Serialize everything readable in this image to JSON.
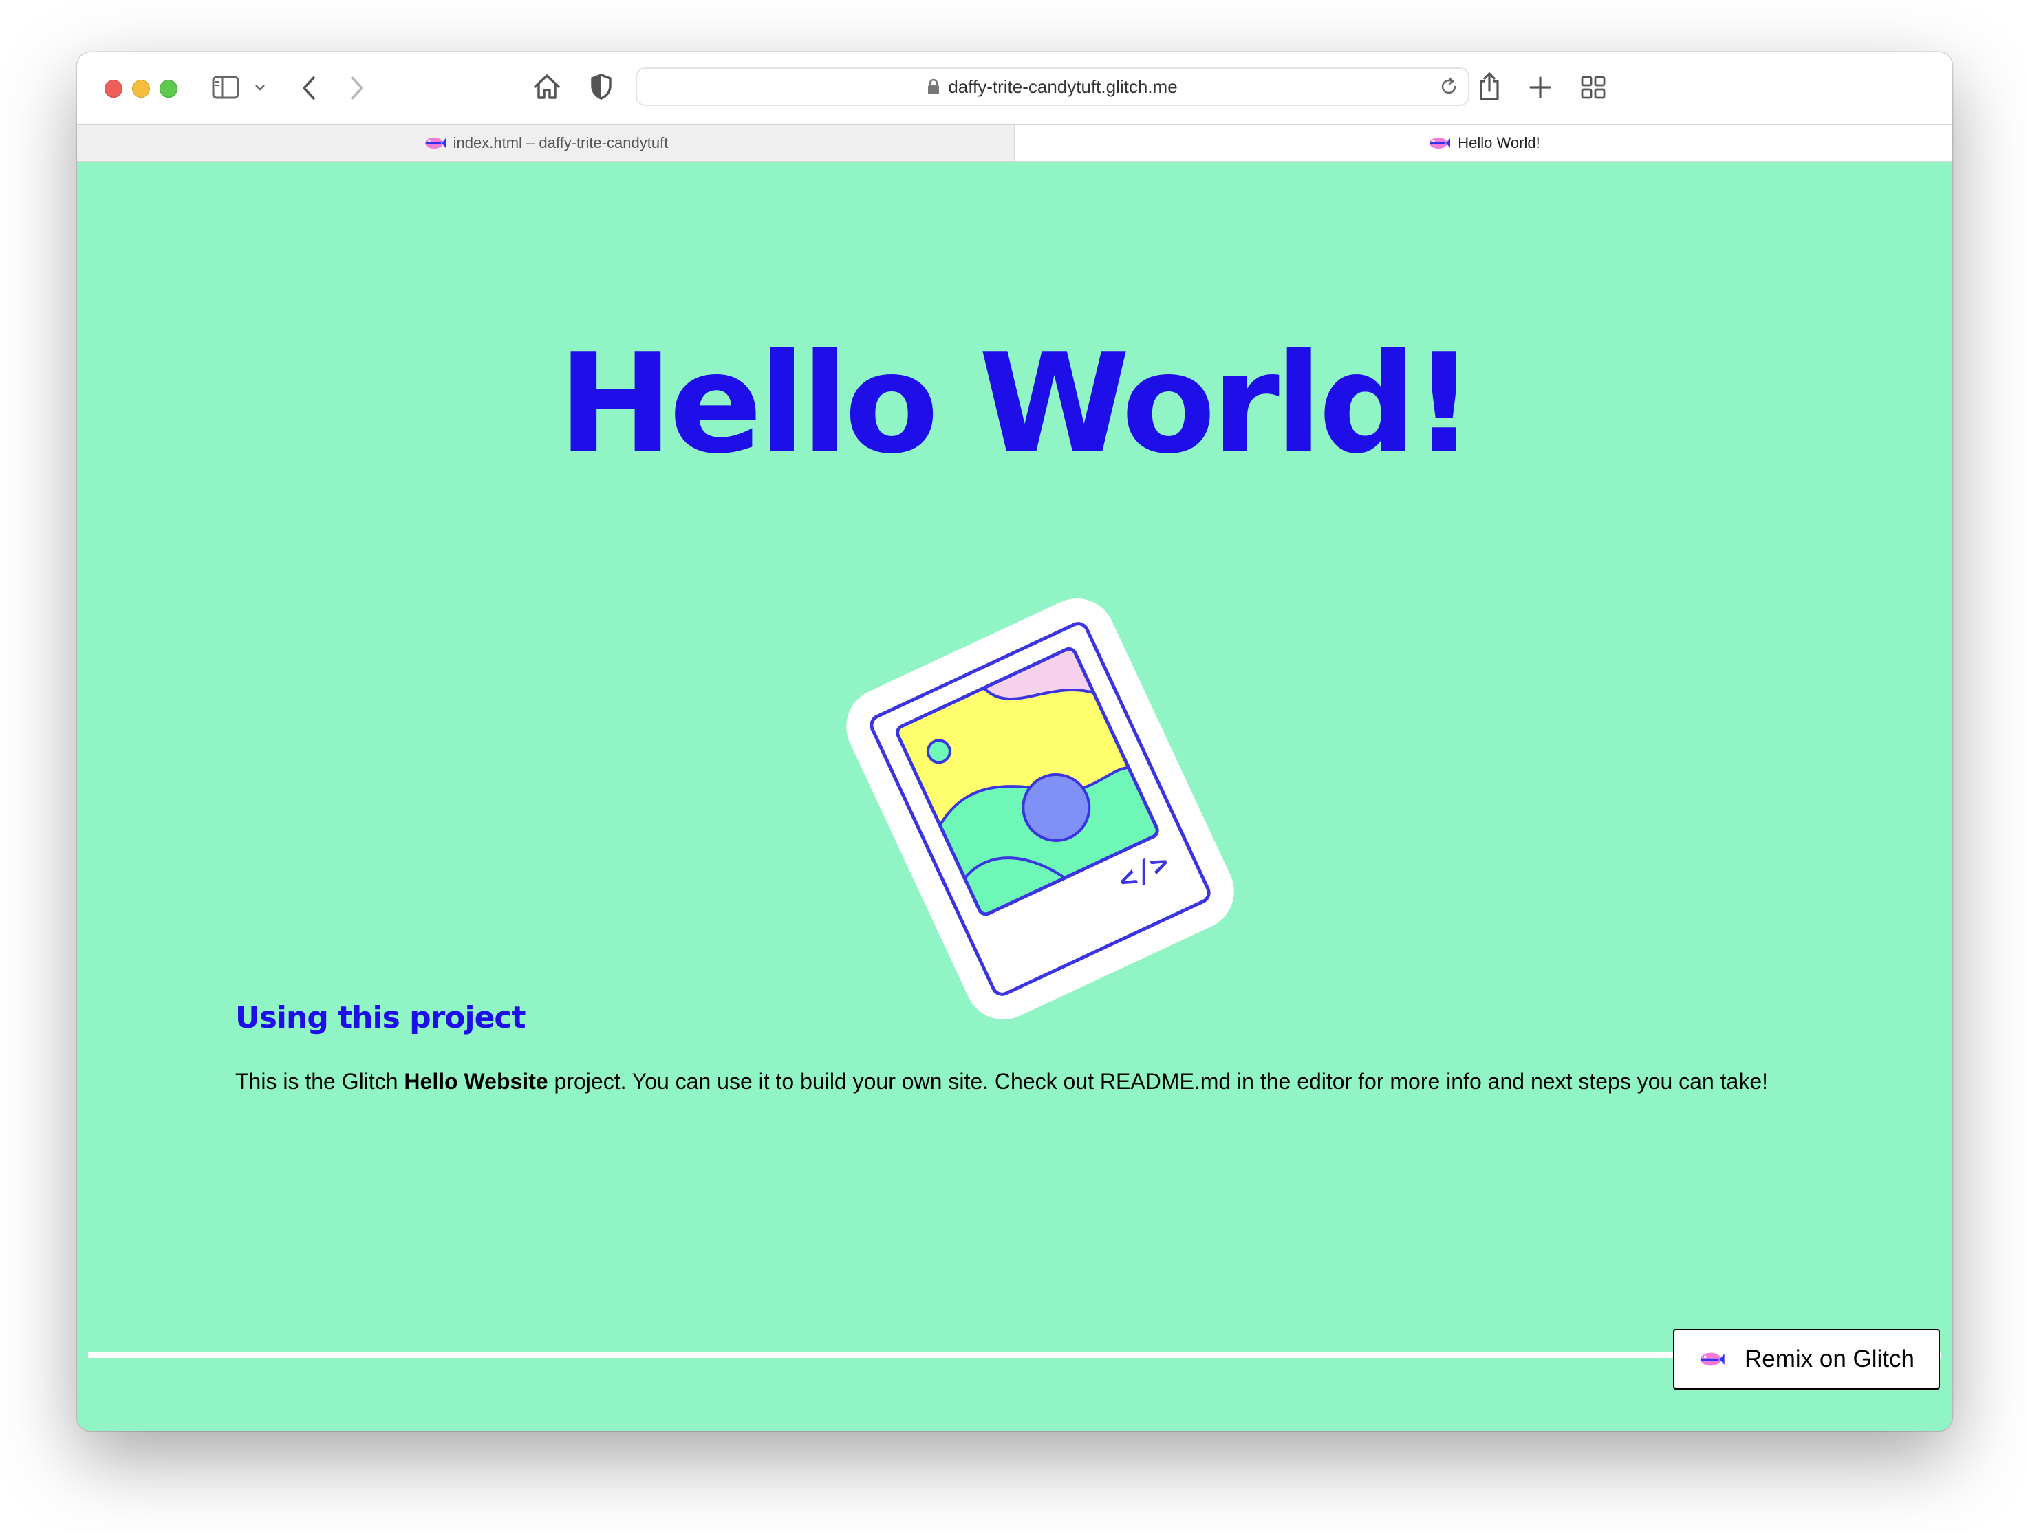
{
  "browser": {
    "url": "daffy-trite-candytuft.glitch.me",
    "tabs": [
      {
        "label": "index.html – daffy-trite-candytuft",
        "active": false
      },
      {
        "label": "Hello World!",
        "active": true
      }
    ],
    "icons": [
      "sidebar-icon",
      "chevron-down-icon",
      "back-icon",
      "forward-icon",
      "home-icon",
      "shield-icon",
      "lock-icon",
      "reload-icon",
      "share-icon",
      "new-tab-icon",
      "tab-overview-icon"
    ]
  },
  "page": {
    "background": "#91f4c5",
    "accent": "#1e0fe8",
    "title": "Hello World!",
    "section_heading": "Using this project",
    "body": {
      "before": "This is the Glitch ",
      "bold": "Hello Website",
      "after": " project. You can use it to build your own site. Check out README.md in the editor for more info and next steps you can take!"
    },
    "illustration_code_mark": "</>",
    "remix_button": "Remix on Glitch"
  }
}
